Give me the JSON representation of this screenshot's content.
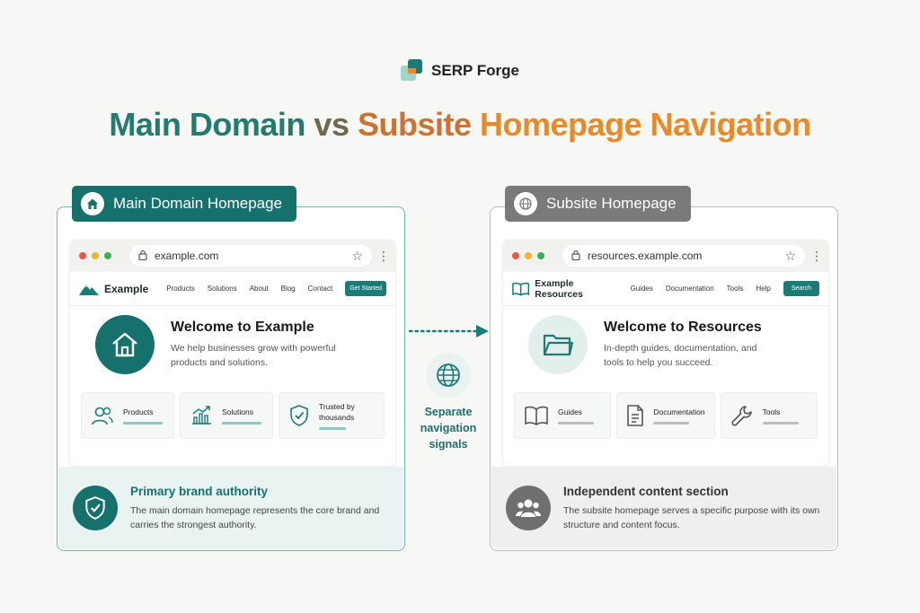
{
  "brand": {
    "name": "SERP Forge"
  },
  "title": {
    "part1": "Main Domain",
    "part2": "vs",
    "part3": "Subsite",
    "part4": "Homepage Navigation"
  },
  "colors": {
    "teal": "#16706c",
    "gray": "#7a7a7a",
    "orange": "#e68a2a"
  },
  "left": {
    "tag": "Main Domain Homepage",
    "url": "example.com",
    "site_name": "Example",
    "nav": [
      "Products",
      "Solutions",
      "About",
      "Blog",
      "Contact"
    ],
    "cta": "Get Started",
    "hero_title": "Welcome to Example",
    "hero_desc": "We help businesses grow with powerful products and solutions.",
    "features": [
      {
        "label": "Products",
        "icon": "users-icon"
      },
      {
        "label": "Solutions",
        "icon": "chart-icon"
      },
      {
        "label": "Trusted by thousands",
        "icon": "shield-check-icon"
      }
    ],
    "foot_title": "Primary brand authority",
    "foot_desc": "The main domain homepage represents the core brand and carries the strongest authority."
  },
  "middle": {
    "label": "Separate navigation signals",
    "icon": "globe-icon"
  },
  "right": {
    "tag": "Subsite Homepage",
    "url": "resources.example.com",
    "site_name": "Example Resources",
    "nav": [
      "Guides",
      "Documentation",
      "Tools",
      "Help"
    ],
    "cta": "Search",
    "hero_title": "Welcome to Resources",
    "hero_desc": "In-depth guides, documentation, and tools to help you succeed.",
    "features": [
      {
        "label": "Guides",
        "icon": "book-icon"
      },
      {
        "label": "Documentation",
        "icon": "document-icon"
      },
      {
        "label": "Tools",
        "icon": "wrench-icon"
      }
    ],
    "foot_title": "Independent content section",
    "foot_desc": "The subsite homepage serves a specific purpose with its own structure and content focus."
  }
}
